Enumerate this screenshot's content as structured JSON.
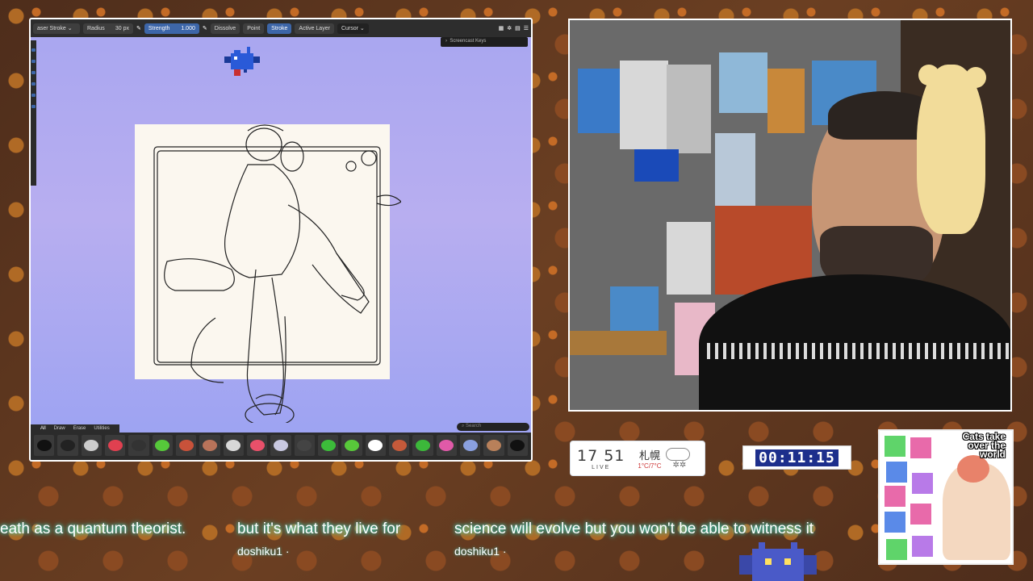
{
  "blender": {
    "toolbar": {
      "tool": "aser Stroke",
      "radius_label": "Radius",
      "radius_value": "30 px",
      "strength_label": "Strength",
      "strength_value": "1.000",
      "dissolve": "Dissolve",
      "point": "Point",
      "stroke": "Stroke",
      "active_layer": "Active Layer",
      "cursor": "Cursor"
    },
    "screencast_keys": "Screencast Keys",
    "brush_tabs": [
      "All",
      "Draw",
      "Erase",
      "Utilities"
    ],
    "search_placeholder": "Search",
    "brush_colors": [
      "#111111",
      "#222222",
      "#cccccc",
      "#e04050",
      "#333333",
      "#56c83a",
      "#c8523a",
      "#b8735a",
      "#d8d8d8",
      "#e8506a",
      "#c8c8e0",
      "#444444",
      "#3cbc3a",
      "#58c83a",
      "#ffffff",
      "#c45a3a",
      "#3cb83a",
      "#e05aa8",
      "#8aa0e0",
      "#b8805a",
      "#111111"
    ]
  },
  "clock": {
    "time": "17 51",
    "live": "LIVE",
    "city": "札幌",
    "temp": "1°C/7°C"
  },
  "timer": {
    "value": "00:11:15"
  },
  "book": {
    "title": "Cats take over the world"
  },
  "captions": [
    {
      "text": "eath as a quantum theorist."
    },
    {
      "text": "but it's what they live for",
      "user": "doshiku1 ·"
    },
    {
      "text": "science will evolve but you won't be able to witness it",
      "user": "doshiku1 ·"
    }
  ],
  "colors": {
    "accent_blue": "#3d66a8",
    "caption_glow": "#3de3c8",
    "timer_bg": "#1d2f8c"
  }
}
